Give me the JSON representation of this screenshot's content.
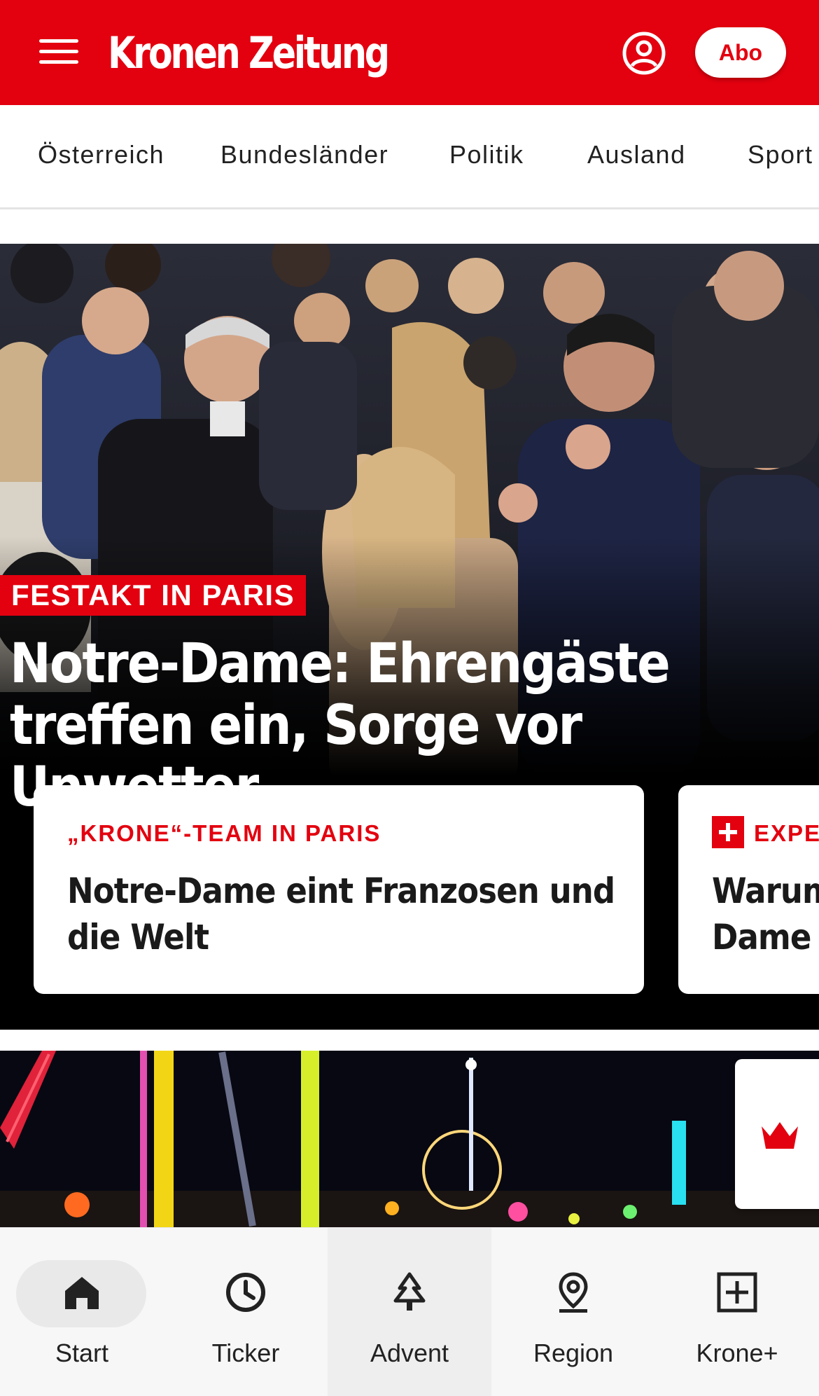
{
  "header": {
    "logo_text": "Kronen Zeitung",
    "abo_label": "Abo",
    "brand_color": "#e3000f"
  },
  "nav": {
    "items": [
      "Österreich",
      "Bundesländer",
      "Politik",
      "Ausland",
      "Sport"
    ]
  },
  "hero": {
    "kicker": "FESTAKT IN PARIS",
    "headline_line1": "Notre-Dame: Ehrengäste",
    "headline_line2": "treffen ein, Sorge vor Unwetter"
  },
  "cards": [
    {
      "kicker": "„KRONE“-TEAM IN PARIS",
      "title": "Notre-Dame eint Franzosen und die Welt"
    },
    {
      "kicker": "EXPE",
      "title_line1": "Warum",
      "title_line2": "Dame s",
      "badge_icon": "plus-icon"
    }
  ],
  "bottom_nav": {
    "items": [
      {
        "label": "Start",
        "icon": "home-icon"
      },
      {
        "label": "Ticker",
        "icon": "clock-icon"
      },
      {
        "label": "Advent",
        "icon": "tree-icon"
      },
      {
        "label": "Region",
        "icon": "location-pin-icon"
      },
      {
        "label": "Krone+",
        "icon": "plus-square-icon"
      }
    ]
  }
}
